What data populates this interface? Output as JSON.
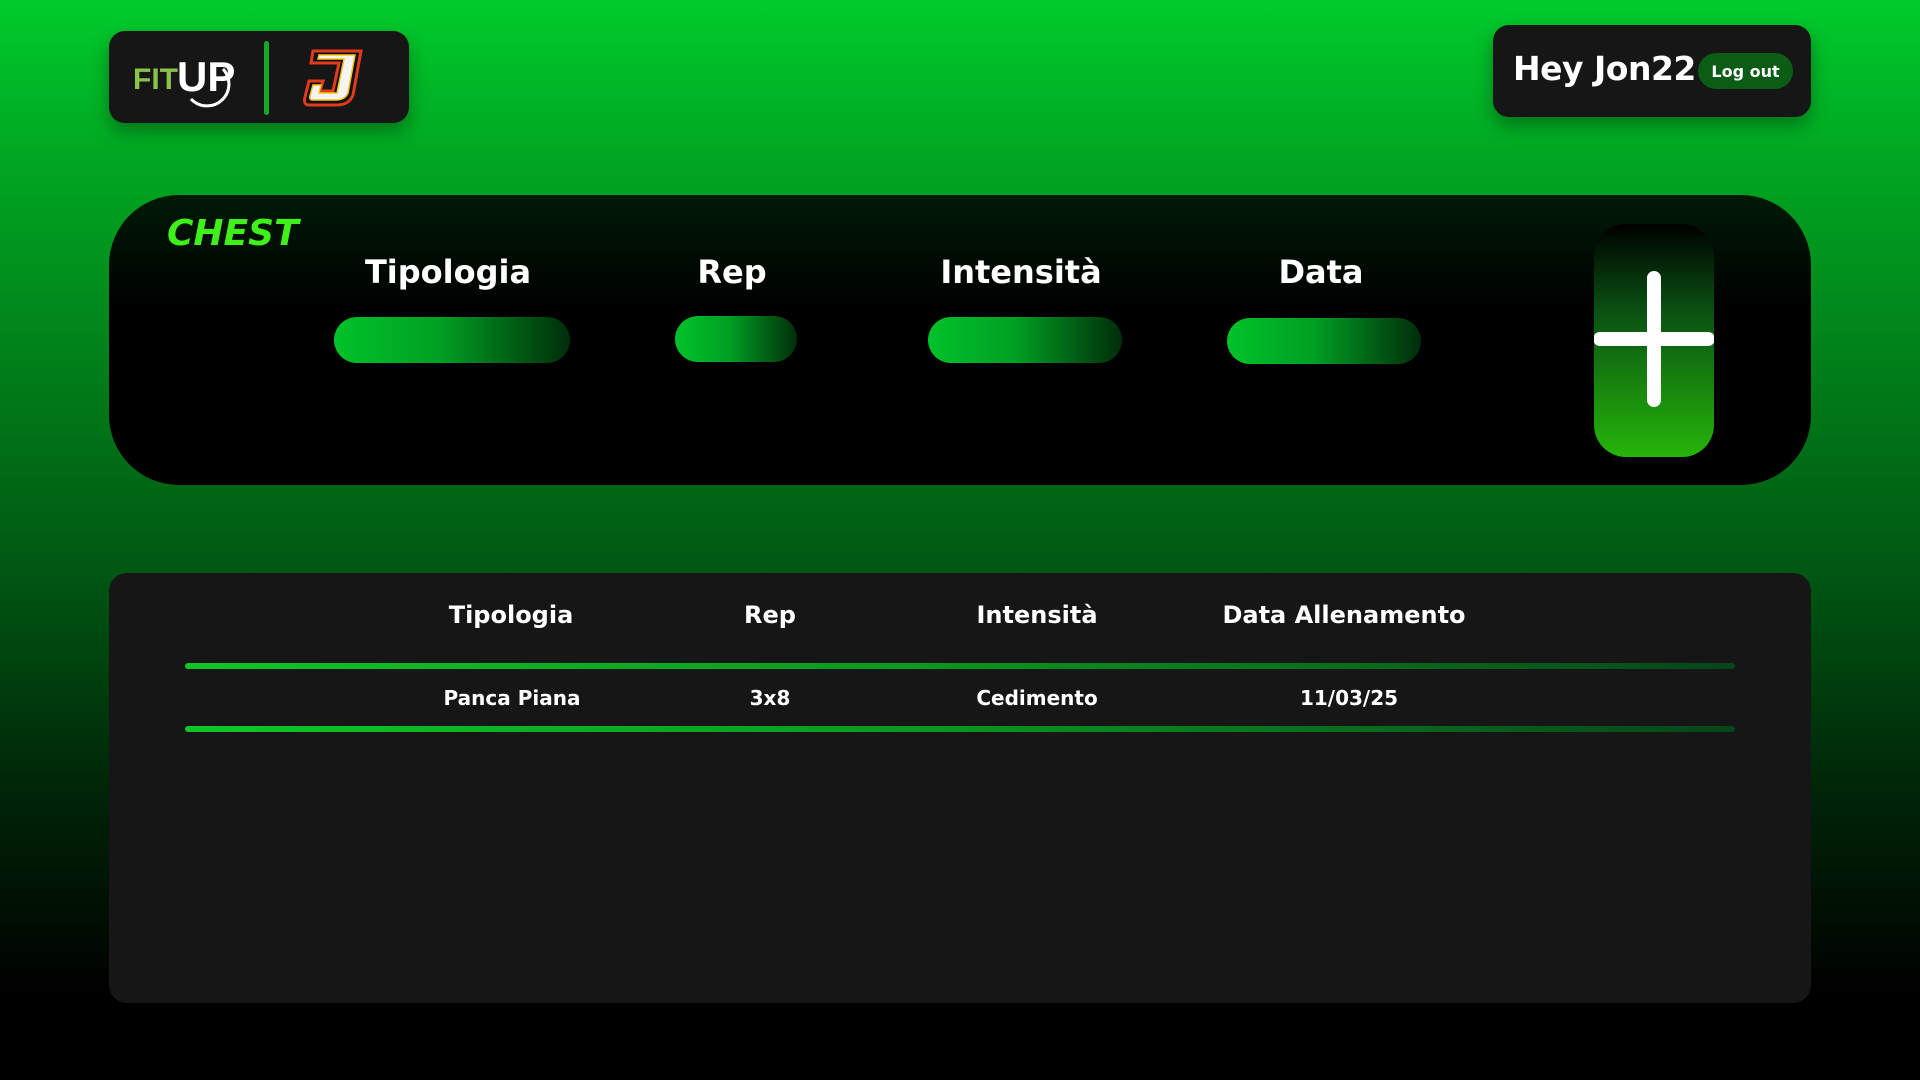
{
  "header": {
    "logo_fitup_text": "FITUP",
    "logo_brand_letter": "J",
    "greeting": "Hey Jon22",
    "logout_label": "Log out"
  },
  "form": {
    "section_title": "CHEST",
    "labels": {
      "tipologia": "Tipologia",
      "rep": "Rep",
      "intensita": "Intensità",
      "data": "Data"
    },
    "values": {
      "tipologia": "",
      "rep": "",
      "intensita": "",
      "data": ""
    },
    "add_icon": "plus-icon"
  },
  "table": {
    "headers": [
      "Tipologia",
      "Rep",
      "Intensità",
      "Data Allenamento"
    ],
    "rows": [
      [
        "Panca Piana",
        "3x8",
        "Cedimento",
        "11/03/25"
      ]
    ]
  },
  "colors": {
    "accent_green": "#3ff01a",
    "panel_dark": "#161616",
    "logout_bg": "#0b5c14"
  }
}
